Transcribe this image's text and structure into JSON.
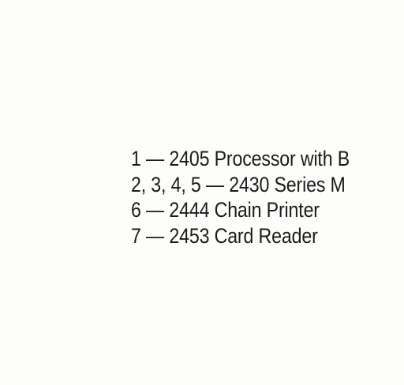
{
  "caption": {
    "lines": [
      "1 — 2405 Processor with B",
      "2, 3, 4, 5 — 2430 Series M",
      "6 — 2444 Chain Printer",
      "7 — 2453 Card Reader"
    ]
  }
}
